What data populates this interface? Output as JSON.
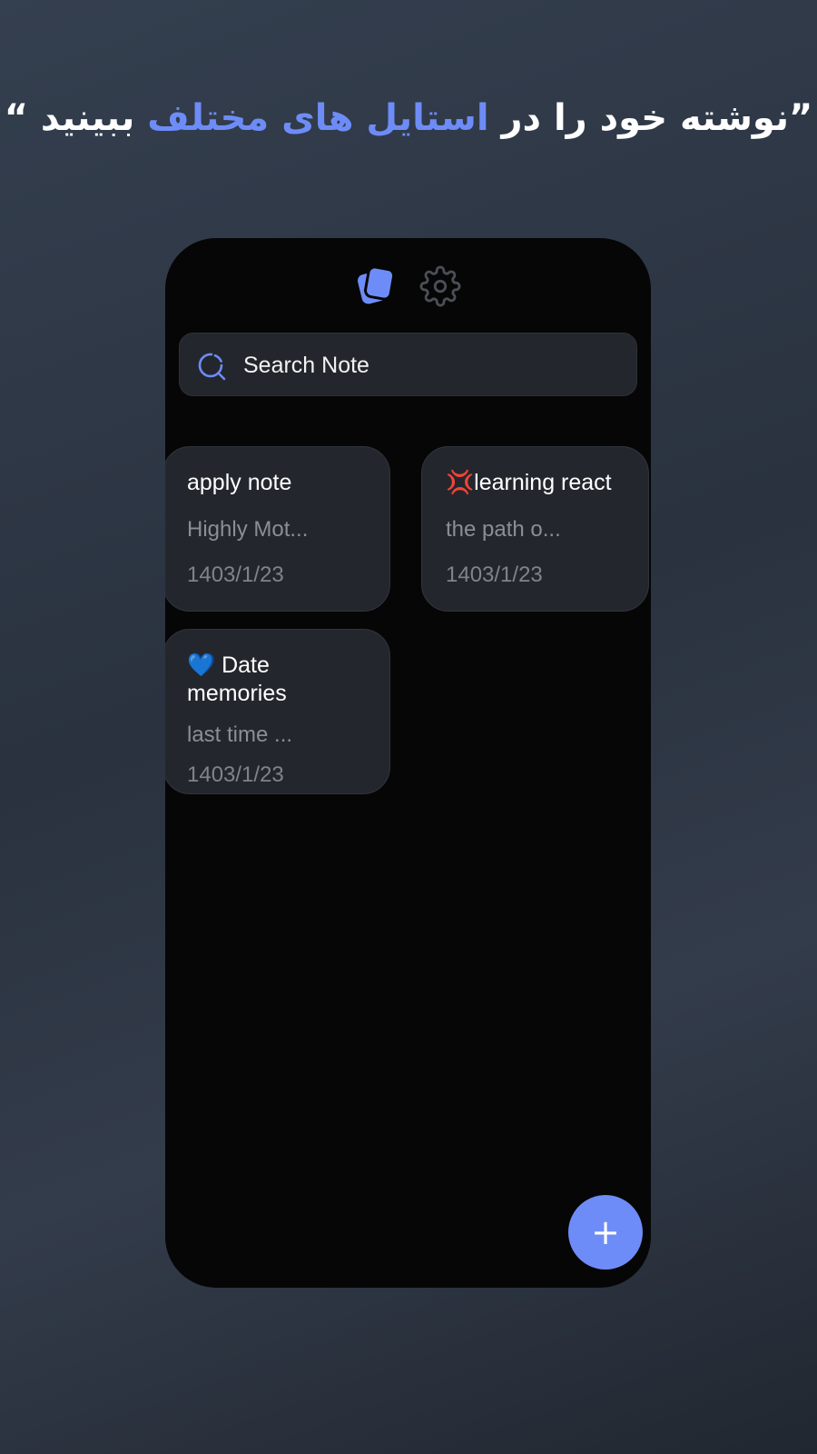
{
  "headline": {
    "open_quote": "”",
    "part1": "نوشته  خود را در ",
    "accent": "استایل های مختلف",
    "part2": " ببینید",
    "close_quote": " “"
  },
  "colors": {
    "accent": "#6e8cf7",
    "screen_bg": "#060606",
    "card_bg": "#23272d",
    "muted_text": "#8b8f95"
  },
  "toolbar": {
    "notes_icon": "notes-stack-icon",
    "settings_icon": "gear-icon"
  },
  "search": {
    "placeholder": "Search Note",
    "icon": "search-icon"
  },
  "notes": [
    {
      "emoji": "",
      "title": "apply note",
      "preview": "Highly Mot...",
      "date": "1403/1/23"
    },
    {
      "emoji": "💢",
      "title": "learning react",
      "preview": "the path o...",
      "date": "1403/1/23"
    },
    {
      "emoji": "💙",
      "title": " Date memories",
      "preview": "last time ...",
      "date": "1403/1/23"
    }
  ],
  "fab": {
    "label": "+",
    "icon": "plus-icon"
  }
}
